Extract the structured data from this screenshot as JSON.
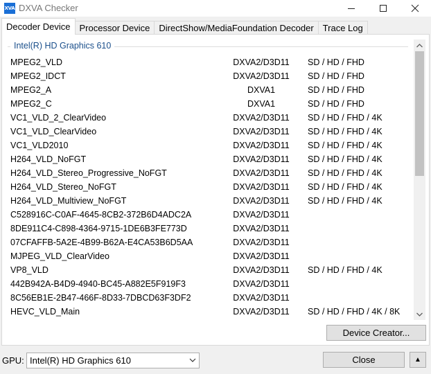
{
  "window": {
    "icon_text": "XVA",
    "title": "DXVA Checker"
  },
  "tabs": [
    {
      "label": "Decoder Device",
      "active": true
    },
    {
      "label": "Processor Device",
      "active": false
    },
    {
      "label": "DirectShow/MediaFoundation Decoder",
      "active": false
    },
    {
      "label": "Trace Log",
      "active": false
    }
  ],
  "group": {
    "label": "Intel(R) HD Graphics 610"
  },
  "decoders": [
    {
      "name": "MPEG2_VLD",
      "api": "DXVA2/D3D11",
      "res": "SD / HD / FHD"
    },
    {
      "name": "MPEG2_IDCT",
      "api": "DXVA2/D3D11",
      "res": "SD / HD / FHD"
    },
    {
      "name": "MPEG2_A",
      "api": "DXVA1",
      "res": "SD / HD / FHD"
    },
    {
      "name": "MPEG2_C",
      "api": "DXVA1",
      "res": "SD / HD / FHD"
    },
    {
      "name": "VC1_VLD_2_ClearVideo",
      "api": "DXVA2/D3D11",
      "res": "SD / HD / FHD / 4K"
    },
    {
      "name": "VC1_VLD_ClearVideo",
      "api": "DXVA2/D3D11",
      "res": "SD / HD / FHD / 4K"
    },
    {
      "name": "VC1_VLD2010",
      "api": "DXVA2/D3D11",
      "res": "SD / HD / FHD / 4K"
    },
    {
      "name": "H264_VLD_NoFGT",
      "api": "DXVA2/D3D11",
      "res": "SD / HD / FHD / 4K"
    },
    {
      "name": "H264_VLD_Stereo_Progressive_NoFGT",
      "api": "DXVA2/D3D11",
      "res": "SD / HD / FHD / 4K"
    },
    {
      "name": "H264_VLD_Stereo_NoFGT",
      "api": "DXVA2/D3D11",
      "res": "SD / HD / FHD / 4K"
    },
    {
      "name": "H264_VLD_Multiview_NoFGT",
      "api": "DXVA2/D3D11",
      "res": "SD / HD / FHD / 4K"
    },
    {
      "name": "C528916C-C0AF-4645-8CB2-372B6D4ADC2A",
      "api": "DXVA2/D3D11",
      "res": ""
    },
    {
      "name": "8DE911C4-C898-4364-9715-1DE6B3FE773D",
      "api": "DXVA2/D3D11",
      "res": ""
    },
    {
      "name": "07CFAFFB-5A2E-4B99-B62A-E4CA53B6D5AA",
      "api": "DXVA2/D3D11",
      "res": ""
    },
    {
      "name": "MJPEG_VLD_ClearVideo",
      "api": "DXVA2/D3D11",
      "res": ""
    },
    {
      "name": "VP8_VLD",
      "api": "DXVA2/D3D11",
      "res": "SD / HD / FHD / 4K"
    },
    {
      "name": "442B942A-B4D9-4940-BC45-A882E5F919F3",
      "api": "DXVA2/D3D11",
      "res": ""
    },
    {
      "name": "8C56EB1E-2B47-466F-8D33-7DBCD63F3DF2",
      "api": "DXVA2/D3D11",
      "res": ""
    },
    {
      "name": "HEVC_VLD_Main",
      "api": "DXVA2/D3D11",
      "res": "SD / HD / FHD / 4K / 8K"
    }
  ],
  "buttons": {
    "device_creator": "Device Creator...",
    "close": "Close",
    "up": "▲"
  },
  "gpu": {
    "label": "GPU:",
    "selected": "Intel(R) HD Graphics 610"
  }
}
